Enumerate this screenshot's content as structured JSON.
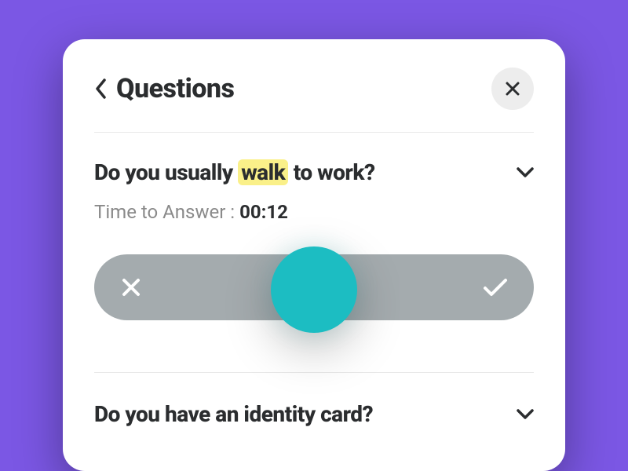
{
  "header": {
    "title": "Questions"
  },
  "question1": {
    "text_prefix": "Do you usually ",
    "highlighted": "walk",
    "text_suffix": " to work?",
    "time_label": "Time to Answer : ",
    "time_value": "00:12"
  },
  "question2": {
    "text": "Do you have an identity card?"
  },
  "colors": {
    "background": "#7b57e4",
    "accent": "#1cbdc2",
    "highlight": "#faf089",
    "track": "#a4abae"
  }
}
